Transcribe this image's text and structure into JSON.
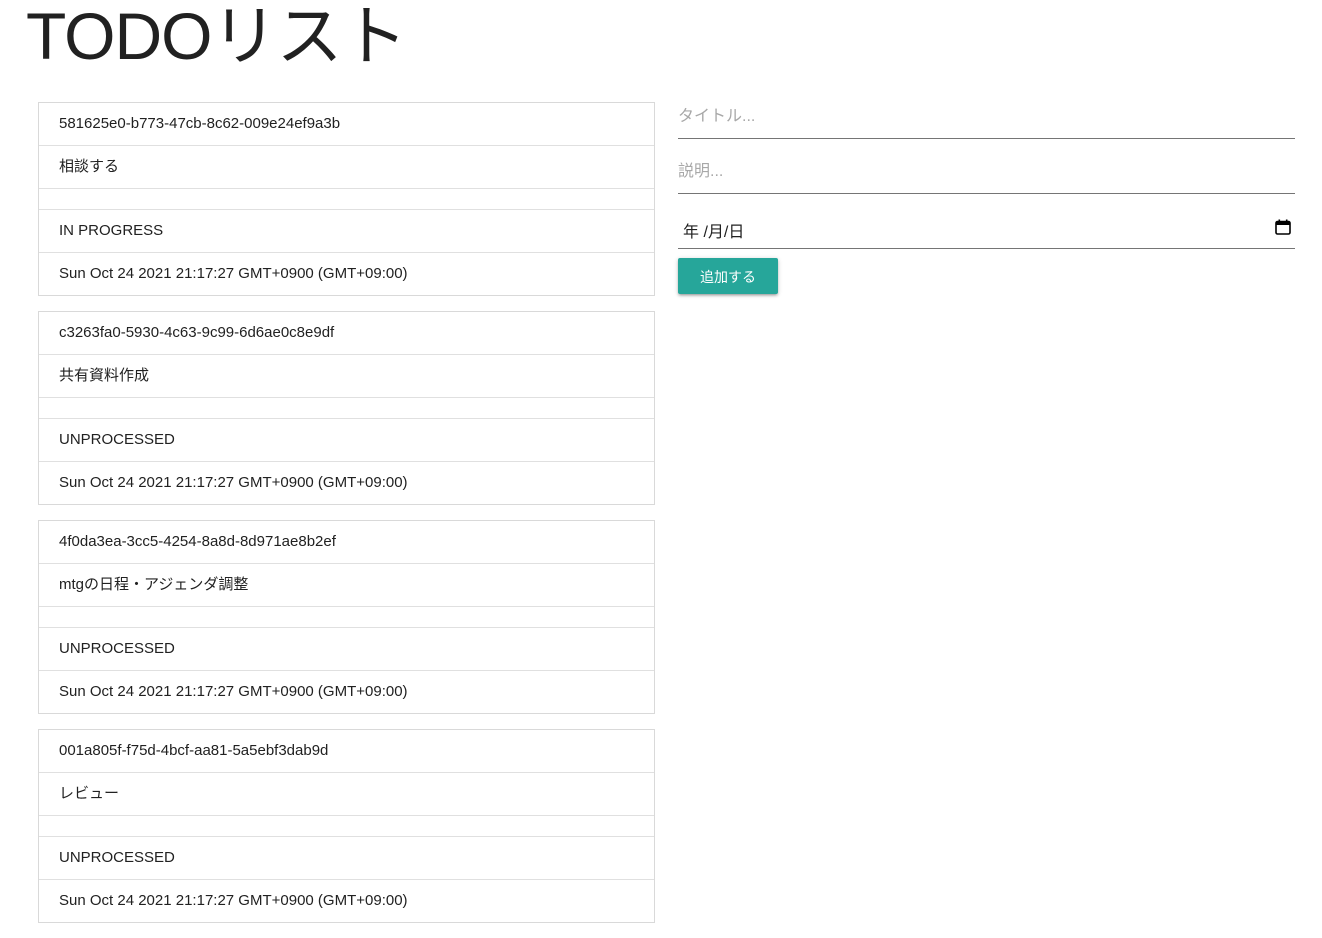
{
  "page": {
    "title": "TODOリスト"
  },
  "todos": [
    {
      "id": "581625e0-b773-47cb-8c62-009e24ef9a3b",
      "title": "相談する",
      "description": "",
      "status": "IN PROGRESS",
      "date": "Sun Oct 24 2021 21:17:27 GMT+0900 (GMT+09:00)"
    },
    {
      "id": "c3263fa0-5930-4c63-9c99-6d6ae0c8e9df",
      "title": "共有資料作成",
      "description": "",
      "status": "UNPROCESSED",
      "date": "Sun Oct 24 2021 21:17:27 GMT+0900 (GMT+09:00)"
    },
    {
      "id": "4f0da3ea-3cc5-4254-8a8d-8d971ae8b2ef",
      "title": "mtgの日程・アジェンダ調整",
      "description": "",
      "status": "UNPROCESSED",
      "date": "Sun Oct 24 2021 21:17:27 GMT+0900 (GMT+09:00)"
    },
    {
      "id": "001a805f-f75d-4bcf-aa81-5a5ebf3dab9d",
      "title": "レビュー",
      "description": "",
      "status": "UNPROCESSED",
      "date": "Sun Oct 24 2021 21:17:27 GMT+0900 (GMT+09:00)"
    }
  ],
  "form": {
    "title_placeholder": "タイトル...",
    "description_placeholder": "説明...",
    "date_value": "年 /月/日",
    "date_icon": "calendar-icon",
    "submit_label": "追加する",
    "submit_color": "#26a69a"
  }
}
